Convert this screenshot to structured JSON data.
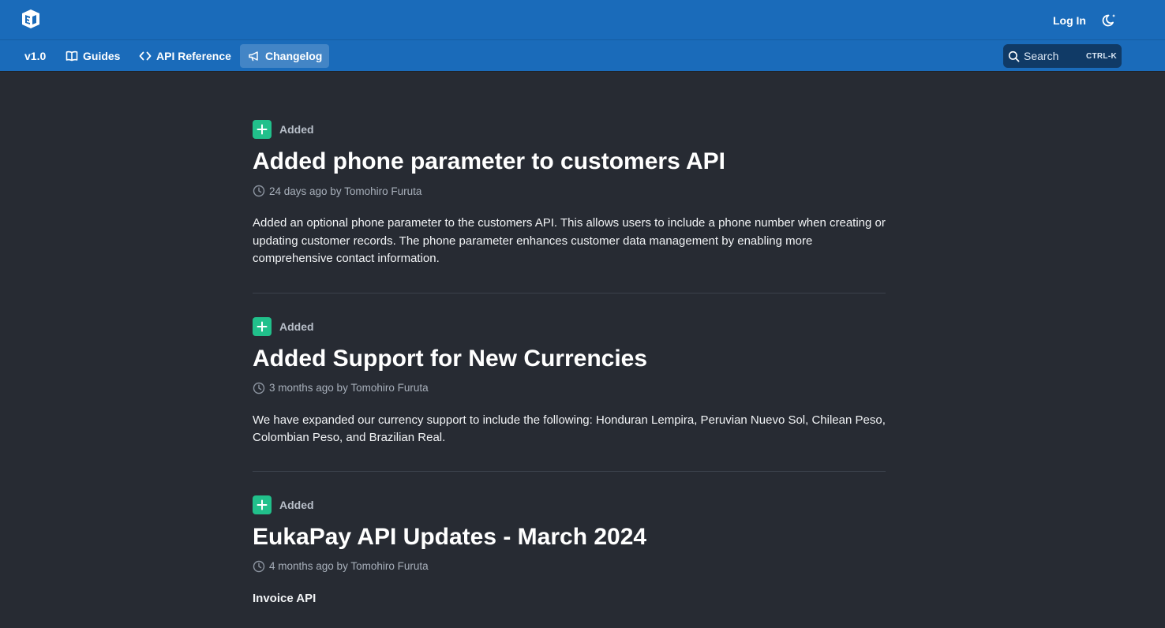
{
  "header": {
    "login_label": "Log In"
  },
  "nav": {
    "items": [
      {
        "label": "v1.0",
        "icon": "version-label",
        "active": false
      },
      {
        "label": "Guides",
        "icon": "book-icon",
        "active": false
      },
      {
        "label": "API Reference",
        "icon": "code-icon",
        "active": false
      },
      {
        "label": "Changelog",
        "icon": "megaphone-icon",
        "active": true
      }
    ]
  },
  "search": {
    "label": "Search",
    "shortcut": "CTRL-K"
  },
  "entries": [
    {
      "tag": "Added",
      "title": "Added phone parameter to customers API",
      "meta": "24 days ago by Tomohiro Furuta",
      "body": "Added an optional phone parameter to the customers API. This allows users to include a phone number when creating or updating customer records. The phone parameter enhances customer data management by enabling more comprehensive contact information."
    },
    {
      "tag": "Added",
      "title": "Added Support for New Currencies",
      "meta": "3 months ago by Tomohiro Furuta",
      "body": "We have expanded our currency support to include the following: Honduran Lempira, Peruvian Nuevo Sol, Chilean Peso, Colombian Peso, and Brazilian Real."
    },
    {
      "tag": "Added",
      "title": "EukaPay API Updates - March 2024",
      "meta": "4 months ago by Tomohiro Furuta",
      "body": "Invoice API"
    }
  ],
  "colors": {
    "header_bg": "#1a6bba",
    "page_bg": "#272b33",
    "badge_green": "#21c08b",
    "search_bg": "#103a66"
  }
}
